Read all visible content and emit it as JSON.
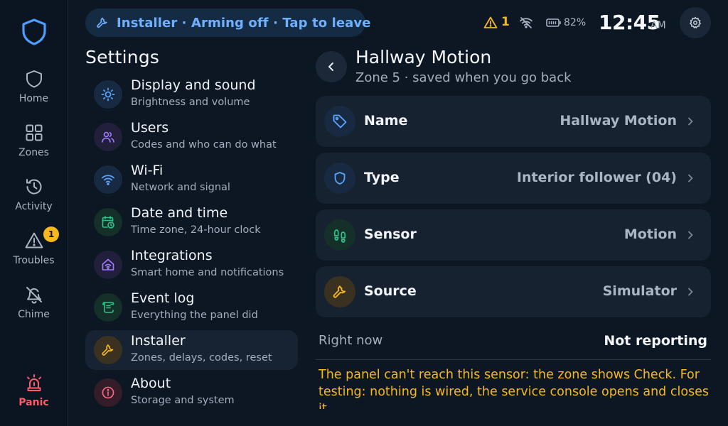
{
  "sidebar": {
    "items": [
      {
        "label": "Home",
        "icon": "shield-icon"
      },
      {
        "label": "Zones",
        "icon": "grid-icon"
      },
      {
        "label": "Activity",
        "icon": "history-icon"
      },
      {
        "label": "Troubles",
        "icon": "warning-icon",
        "badge": "1"
      },
      {
        "label": "Chime",
        "icon": "bell-off-icon"
      }
    ],
    "panic_label": "Panic"
  },
  "status_bar": {
    "installer_pill": "Installer · Arming off · Tap to leave",
    "trouble_count": "1",
    "battery": "82%",
    "time": "12:45",
    "ampm": "AM"
  },
  "settings": {
    "title": "Settings",
    "items": [
      {
        "title": "Display and sound",
        "subtitle": "Brightness and volume",
        "icon": "sun-icon"
      },
      {
        "title": "Users",
        "subtitle": "Codes and who can do what",
        "icon": "users-icon"
      },
      {
        "title": "Wi-Fi",
        "subtitle": "Network and signal",
        "icon": "wifi-icon"
      },
      {
        "title": "Date and time",
        "subtitle": "Time zone, 24-hour clock",
        "icon": "calendar-clock-icon"
      },
      {
        "title": "Integrations",
        "subtitle": "Smart home and notifications",
        "icon": "home-wifi-icon"
      },
      {
        "title": "Event log",
        "subtitle": "Everything the panel did",
        "icon": "scroll-icon"
      },
      {
        "title": "Installer",
        "subtitle": "Zones, delays, codes, reset",
        "icon": "wrench-icon",
        "selected": true
      },
      {
        "title": "About",
        "subtitle": "Storage and system",
        "icon": "info-icon"
      }
    ]
  },
  "detail": {
    "title": "Hallway Motion",
    "subtitle": "Zone 5 · saved when you go back",
    "fields": [
      {
        "label": "Name",
        "value": "Hallway Motion",
        "icon": "tag-icon"
      },
      {
        "label": "Type",
        "value": "Interior follower (04)",
        "icon": "shield-icon"
      },
      {
        "label": "Sensor",
        "value": "Motion",
        "icon": "footprints-icon"
      },
      {
        "label": "Source",
        "value": "Simulator",
        "icon": "wrench-icon"
      }
    ],
    "right_now_label": "Right now",
    "right_now_value": "Not reporting",
    "warning": "The panel can't reach this sensor: the zone shows Check. For testing: nothing is wired, the service console opens and closes it."
  },
  "colors": {
    "accent_blue": "#6fb0ff",
    "warning_amber": "#f5b81d",
    "panic_red": "#ff5a6a",
    "background": "#0d1724"
  }
}
